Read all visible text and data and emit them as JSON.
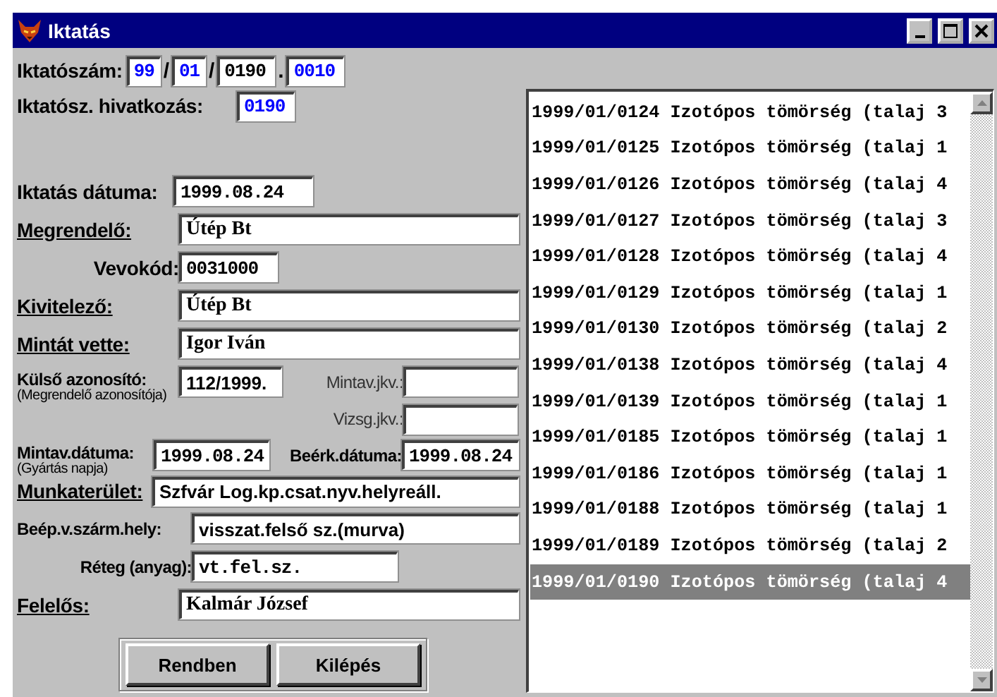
{
  "window": {
    "title": "Iktatás"
  },
  "registry_number": {
    "label": "Iktatószám:",
    "parts": [
      "99",
      "01",
      "0190",
      "0010"
    ],
    "separators": [
      "/",
      "/",
      "."
    ]
  },
  "reference": {
    "label": "Iktatósz. hivatkozás:",
    "value": "0190"
  },
  "order_date": {
    "label": "Iktatás dátuma:",
    "value": "1999.08.24"
  },
  "customer": {
    "label": "Megrendelő:",
    "value": "Útép Bt",
    "kind": "link"
  },
  "customer_code": {
    "label": "Vevokód:",
    "value": "0031000"
  },
  "contractor": {
    "label": "Kivitelező:",
    "value": "Útép Bt",
    "kind": "link"
  },
  "sampled_by": {
    "label": "Mintát vette:",
    "value": "Igor Iván",
    "kind": "link"
  },
  "external_id": {
    "label": "Külső azonosító:",
    "note": "(Megrendelő azonosítója)",
    "value": "112/1999."
  },
  "sampling_report": {
    "label": "Mintav.jkv.:"
  },
  "test_report": {
    "label": "Vizsg.jkv.:"
  },
  "sampling_date": {
    "label": "Mintav.dátuma:",
    "note": "(Gyártás napja)",
    "value": "1999.08.24"
  },
  "received_date": {
    "label": "Beérk.dátuma:",
    "value": "1999.08.24"
  },
  "work_area": {
    "label": "Munkaterület:",
    "value": "Szfvár Log.kp.csat.nyv.helyreáll.",
    "kind": "link"
  },
  "origin_place": {
    "label": "Beép.v.szárm.hely:",
    "value": "visszat.felső sz.(murva)"
  },
  "layer": {
    "label": "Réteg (anyag):",
    "value": "vt.fel.sz."
  },
  "responsible": {
    "label": "Felelős:",
    "value": "Kalmár József",
    "kind": "link"
  },
  "buttons": [
    "Rendben",
    "Kilépés"
  ],
  "list": [
    {
      "text": "1999/01/0124 Izotópos tömörség (talaj 3",
      "selected": false
    },
    {
      "text": "1999/01/0125 Izotópos tömörség (talaj 1",
      "selected": false
    },
    {
      "text": "1999/01/0126 Izotópos tömörség (talaj 4",
      "selected": false
    },
    {
      "text": "1999/01/0127 Izotópos tömörség (talaj 3",
      "selected": false
    },
    {
      "text": "1999/01/0128 Izotópos tömörség (talaj 4",
      "selected": false
    },
    {
      "text": "1999/01/0129 Izotópos tömörség (talaj 1",
      "selected": false
    },
    {
      "text": "1999/01/0130 Izotópos tömörség (talaj 2",
      "selected": false
    },
    {
      "text": "1999/01/0138 Izotópos tömörség (talaj 4",
      "selected": false
    },
    {
      "text": "1999/01/0139 Izotópos tömörség (talaj 1",
      "selected": false
    },
    {
      "text": "1999/01/0185 Izotópos tömörség (talaj 1",
      "selected": false
    },
    {
      "text": "1999/01/0186 Izotópos tömörség (talaj 1",
      "selected": false
    },
    {
      "text": "1999/01/0188 Izotópos tömörség (talaj 1",
      "selected": false
    },
    {
      "text": "1999/01/0189 Izotópos tömörség (talaj 2",
      "selected": false
    },
    {
      "text": "1999/01/0190 Izotópos tömörség (talaj 4",
      "selected": true
    }
  ]
}
